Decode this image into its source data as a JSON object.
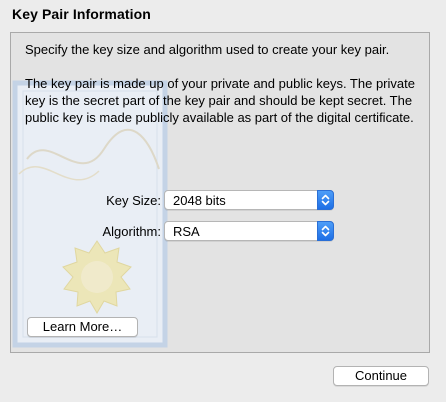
{
  "section": {
    "title": "Key Pair Information"
  },
  "content": {
    "paragraph1": "Specify the key size and algorithm used to create your key pair.",
    "paragraph2": "The key pair is made up of your private and public keys. The private key is the secret part of the key pair and should be kept secret. The public key is made publicly available as part of the digital certificate."
  },
  "fields": {
    "key_size": {
      "label": "Key Size:",
      "value": "2048 bits"
    },
    "algorithm": {
      "label": "Algorithm:",
      "value": "RSA"
    }
  },
  "buttons": {
    "learn_more": "Learn More…",
    "continue": "Continue"
  },
  "colors": {
    "accent": "#1e6fe6",
    "background": "#ececec"
  },
  "icons": {
    "popup_stepper": "up-down-chevron-icon",
    "watermark": "certificate-icon"
  }
}
